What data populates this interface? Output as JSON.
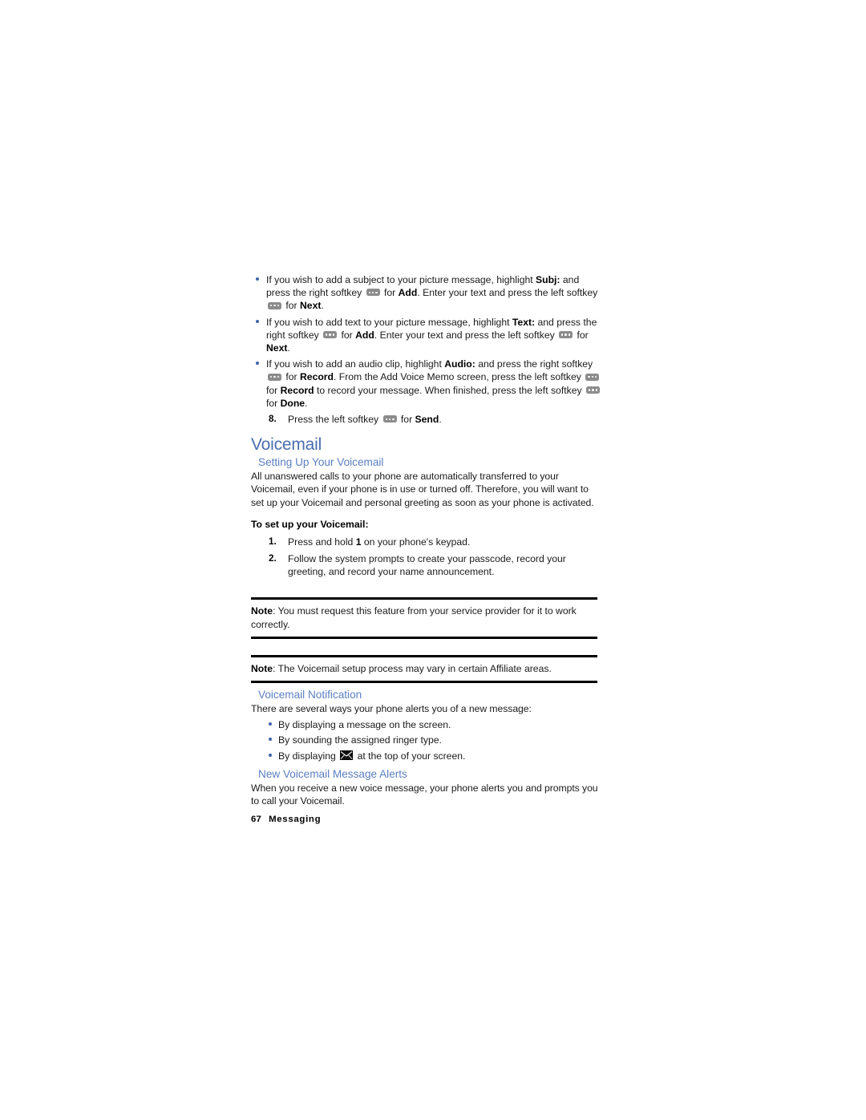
{
  "document": {
    "page_number": "67",
    "chapter": "Messaging",
    "colors": {
      "heading": "#4a6db0",
      "subheading": "#5b7fc0",
      "bullet": "#3f63ae",
      "rule": "#000000",
      "softkey": "#8c8c8c"
    }
  },
  "picture_message_steps": {
    "bullets": [
      {
        "parts": [
          {
            "t": "text",
            "v": "If you wish to add a subject to your picture message, highlight "
          },
          {
            "t": "bold",
            "v": "Subj:"
          },
          {
            "t": "text",
            "v": " and press the right softkey "
          },
          {
            "t": "softkey"
          },
          {
            "t": "text",
            "v": " for "
          },
          {
            "t": "bold",
            "v": "Add"
          },
          {
            "t": "text",
            "v": ". Enter your text and press the left softkey "
          },
          {
            "t": "softkey"
          },
          {
            "t": "text",
            "v": " for "
          },
          {
            "t": "bold",
            "v": "Next"
          },
          {
            "t": "text",
            "v": "."
          }
        ]
      },
      {
        "parts": [
          {
            "t": "text",
            "v": "If you wish to add text to your picture message, highlight "
          },
          {
            "t": "bold",
            "v": "Text:"
          },
          {
            "t": "text",
            "v": " and press the right softkey "
          },
          {
            "t": "softkey"
          },
          {
            "t": "text",
            "v": " for "
          },
          {
            "t": "bold",
            "v": "Add"
          },
          {
            "t": "text",
            "v": ". Enter your text and press the left softkey "
          },
          {
            "t": "softkey"
          },
          {
            "t": "text",
            "v": " for "
          },
          {
            "t": "bold",
            "v": "Next"
          },
          {
            "t": "text",
            "v": "."
          }
        ]
      },
      {
        "parts": [
          {
            "t": "text",
            "v": "If you wish to add an audio clip, highlight "
          },
          {
            "t": "bold",
            "v": "Audio:"
          },
          {
            "t": "text",
            "v": " and press the right softkey "
          },
          {
            "t": "softkey"
          },
          {
            "t": "text",
            "v": " for "
          },
          {
            "t": "bold",
            "v": "Record"
          },
          {
            "t": "text",
            "v": ". From the Add Voice Memo screen, press the left softkey "
          },
          {
            "t": "softkey"
          },
          {
            "t": "text",
            "v": " for "
          },
          {
            "t": "bold",
            "v": "Record"
          },
          {
            "t": "text",
            "v": " to record your message. When finished, press the left softkey "
          },
          {
            "t": "softkey"
          },
          {
            "t": "text",
            "v": " for "
          },
          {
            "t": "bold",
            "v": "Done"
          },
          {
            "t": "text",
            "v": "."
          }
        ]
      }
    ],
    "step8": {
      "number": "8.",
      "parts": [
        {
          "t": "text",
          "v": "Press the left softkey "
        },
        {
          "t": "softkey"
        },
        {
          "t": "text",
          "v": " for "
        },
        {
          "t": "bold",
          "v": "Send"
        },
        {
          "t": "text",
          "v": "."
        }
      ]
    }
  },
  "voicemail": {
    "title": "Voicemail",
    "setting_up": {
      "heading": "Setting Up Your Voicemail",
      "paragraph": "All unanswered calls to your phone are automatically transferred to your Voicemail, even if your phone is in use or turned off. Therefore, you will want to set up your Voicemail and personal greeting as soon as your phone is activated.",
      "lead": "To set up your Voicemail:",
      "steps": [
        {
          "number": "1.",
          "parts": [
            {
              "t": "text",
              "v": "Press and hold "
            },
            {
              "t": "bold",
              "v": "1"
            },
            {
              "t": "text",
              "v": " on your phone's keypad."
            }
          ]
        },
        {
          "number": "2.",
          "parts": [
            {
              "t": "text",
              "v": "Follow the system prompts to create your passcode, record your greeting, and record your name announcement."
            }
          ]
        }
      ]
    },
    "notes": [
      {
        "parts": [
          {
            "t": "bold",
            "v": "Note"
          },
          {
            "t": "text",
            "v": ": You must request this feature from your service provider for it to work correctly."
          }
        ]
      },
      {
        "parts": [
          {
            "t": "bold",
            "v": "Note"
          },
          {
            "t": "text",
            "v": ": The Voicemail setup process may vary in certain Affiliate areas."
          }
        ]
      }
    ],
    "notification": {
      "heading": "Voicemail Notification",
      "intro": "There are several ways your phone alerts you of a new message:",
      "bullets": [
        {
          "parts": [
            {
              "t": "text",
              "v": "By displaying a message on the screen."
            }
          ]
        },
        {
          "parts": [
            {
              "t": "text",
              "v": "By sounding the assigned ringer type."
            }
          ]
        },
        {
          "parts": [
            {
              "t": "text",
              "v": "By displaying "
            },
            {
              "t": "envelope"
            },
            {
              "t": "text",
              "v": " at the top of your screen."
            }
          ]
        }
      ]
    },
    "new_alerts": {
      "heading": "New Voicemail Message Alerts",
      "paragraph": "When you receive a new voice message, your phone alerts you and prompts you to call your Voicemail."
    }
  }
}
